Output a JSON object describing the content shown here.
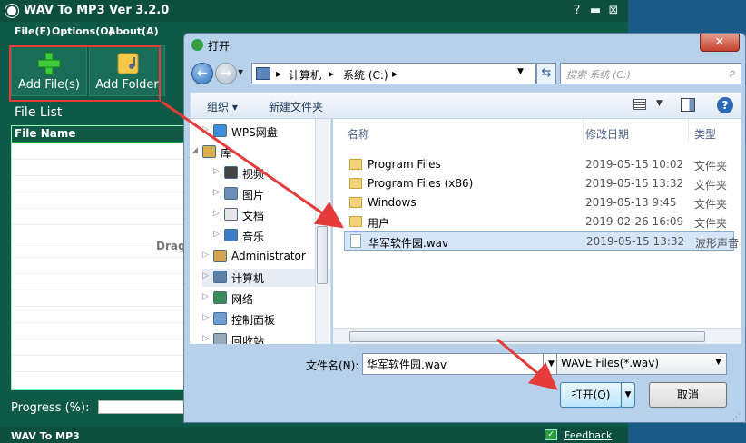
{
  "app": {
    "title": "WAV To MP3",
    "version": "Ver 3.2.0",
    "controls": {
      "help": "?",
      "minimize": "▬",
      "close": "⊠"
    },
    "menu": [
      "File(F)",
      "Options(O)",
      "About(A)"
    ],
    "toolbar": [
      {
        "label": "Add File(s)",
        "icon": "plus-icon"
      },
      {
        "label": "Add Folder",
        "icon": "folder-icon"
      }
    ],
    "file_list_label": "File List",
    "column_header": "File Name",
    "drag_hint": "Drag",
    "progress_label": "Progress (%):",
    "progress_value": 0,
    "status_name": "WAV To MP3",
    "feedback": "Feedback"
  },
  "dialog": {
    "title": "打开",
    "close": "✕",
    "address": {
      "segments": [
        "计算机",
        "系统 (C:)"
      ],
      "sep": "▸"
    },
    "search_placeholder": "搜索 系统 (C:)",
    "organize": "组织 ▾",
    "new_folder": "新建文件夹",
    "help": "?",
    "tree": [
      {
        "label": "WPS网盘",
        "icon": "cloud-icon",
        "color": "#3a8fd8"
      },
      {
        "label": "库",
        "icon": "library-icon",
        "color": "#d8b14a"
      },
      {
        "label": "视频",
        "icon": "video-icon",
        "color": "#444444"
      },
      {
        "label": "图片",
        "icon": "picture-icon",
        "color": "#6b8fb8"
      },
      {
        "label": "文档",
        "icon": "document-icon",
        "color": "#e6e6e6"
      },
      {
        "label": "音乐",
        "icon": "music-icon",
        "color": "#3a7cc8"
      },
      {
        "label": "Administrator",
        "icon": "user-icon",
        "color": "#d6a550"
      },
      {
        "label": "计算机",
        "icon": "computer-icon",
        "color": "#5b7fa8"
      },
      {
        "label": "网络",
        "icon": "network-icon",
        "color": "#3a8a5a"
      },
      {
        "label": "控制面板",
        "icon": "control-panel-icon",
        "color": "#6f9fd0"
      },
      {
        "label": "回收站",
        "icon": "recycle-bin-icon",
        "color": "#9ab"
      }
    ],
    "columns": [
      "名称",
      "修改日期",
      "类型"
    ],
    "files": [
      {
        "name": "Program Files",
        "date": "2019-05-15 10:02",
        "type": "文件夹",
        "kind": "folder"
      },
      {
        "name": "Program Files (x86)",
        "date": "2019-05-15 13:32",
        "type": "文件夹",
        "kind": "folder"
      },
      {
        "name": "Windows",
        "date": "2019-05-13 9:45",
        "type": "文件夹",
        "kind": "folder"
      },
      {
        "name": "用户",
        "date": "2019-02-26 16:09",
        "type": "文件夹",
        "kind": "folder"
      },
      {
        "name": "华军软件园.wav",
        "date": "2019-05-15 13:32",
        "type": "波形声音",
        "kind": "wav"
      }
    ],
    "filename_label": "文件名(N):",
    "filename_value": "华军软件园.wav",
    "filetype_value": "WAVE Files(*.wav)",
    "open_label": "打开(O)",
    "cancel_label": "取消"
  },
  "colors": {
    "app_bg": "#0f5a46",
    "highlight_box": "#e53b3b",
    "arrow": "#e53b3b",
    "selection": "#d5e6fa"
  }
}
